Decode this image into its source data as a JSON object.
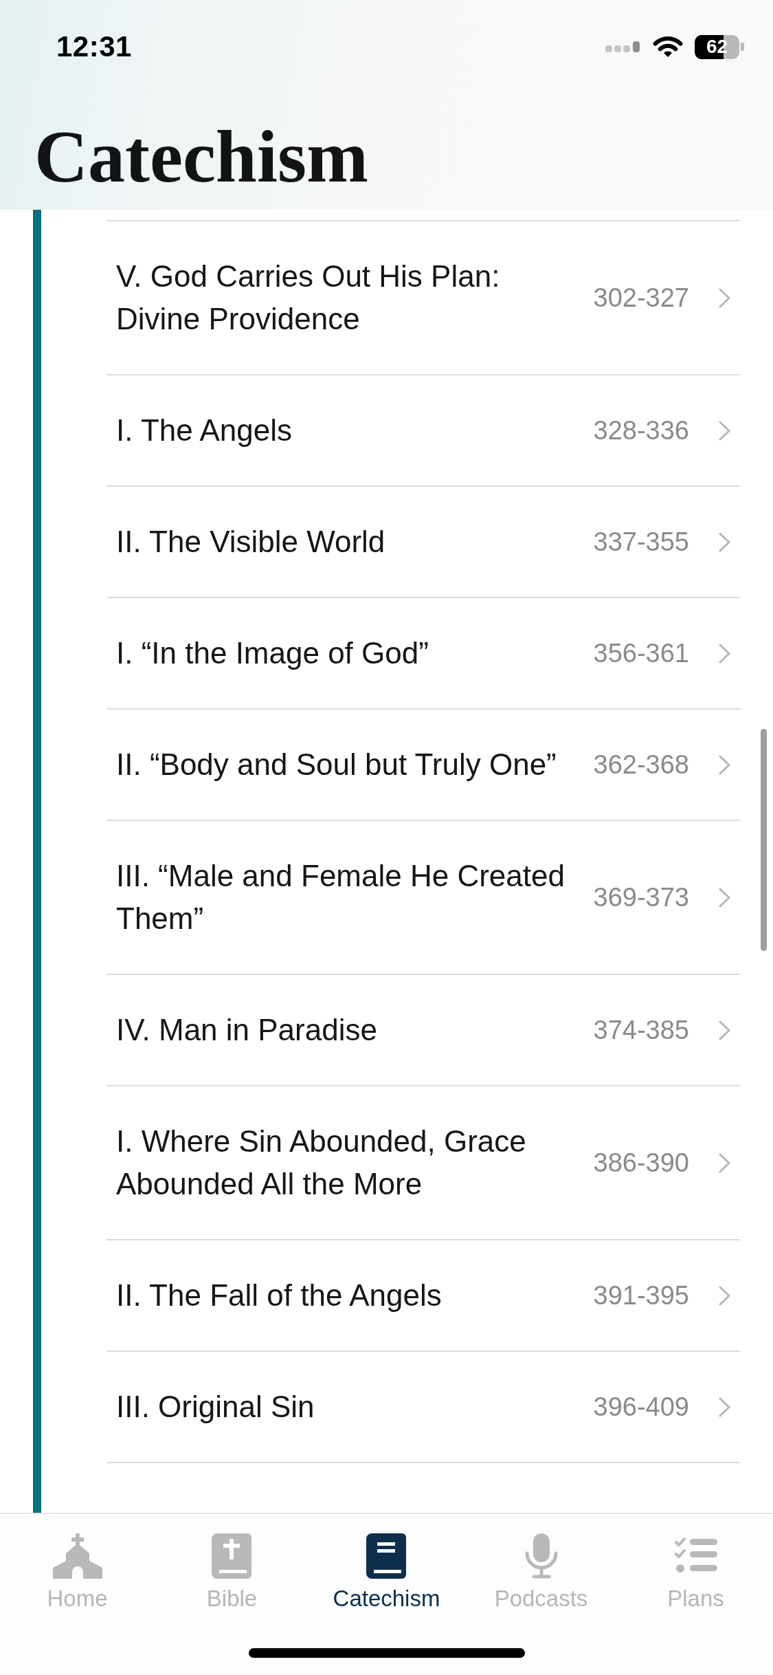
{
  "status_bar": {
    "time": "12:31",
    "battery": "62"
  },
  "title": "Catechism",
  "sections": [
    {
      "title": "V. God Carries Out His Plan: Divine Providence",
      "range": "302-327"
    },
    {
      "title": "I. The Angels",
      "range": "328-336"
    },
    {
      "title": "II. The Visible World",
      "range": "337-355"
    },
    {
      "title": "I. “In the Image of God”",
      "range": "356-361"
    },
    {
      "title": "II. “Body and Soul but Truly One”",
      "range": "362-368"
    },
    {
      "title": "III. “Male and Female He Created Them”",
      "range": "369-373"
    },
    {
      "title": "IV. Man in Paradise",
      "range": "374-385"
    },
    {
      "title": "I. Where Sin Abounded, Grace Abounded All the More",
      "range": "386-390"
    },
    {
      "title": "II. The Fall of the Angels",
      "range": "391-395"
    },
    {
      "title": "III. Original Sin",
      "range": "396-409"
    }
  ],
  "tabs": [
    {
      "label": "Home",
      "selected": false
    },
    {
      "label": "Bible",
      "selected": false
    },
    {
      "label": "Catechism",
      "selected": true
    },
    {
      "label": "Podcasts",
      "selected": false
    },
    {
      "label": "Plans",
      "selected": false
    }
  ]
}
